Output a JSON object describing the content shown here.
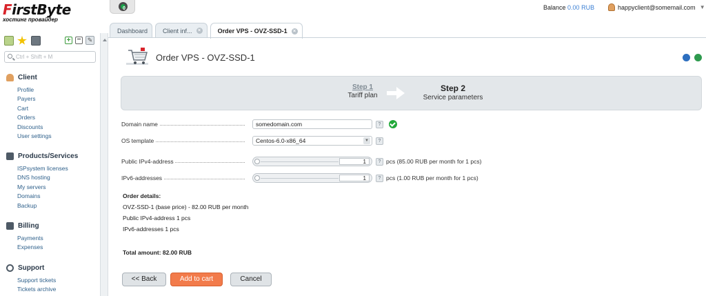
{
  "brand": {
    "logo_main_a": "F",
    "logo_main_b": "irstByte",
    "logo_sub": "хостинг провайдер"
  },
  "notifications": {
    "count": "0"
  },
  "header": {
    "balance_label": "Balance",
    "balance_value": "0.00 RUB",
    "user_email": "happyclient@somemail.com"
  },
  "tabs": [
    {
      "label": "Dashboard",
      "active": false,
      "closable": false
    },
    {
      "label": "Client inf...",
      "active": false,
      "closable": true
    },
    {
      "label": "Order VPS - OVZ-SSD-1",
      "active": true,
      "closable": true
    }
  ],
  "sidebar": {
    "search_placeholder": "Ctrl + Shift + M",
    "sections": [
      {
        "title": "Client",
        "icon": "client-icon",
        "items": [
          "Profile",
          "Payers",
          "Cart",
          "Orders",
          "Discounts",
          "User settings"
        ]
      },
      {
        "title": "Products/Services",
        "icon": "cart-icon",
        "items": [
          "ISPsystem licenses",
          "DNS hosting",
          "My servers",
          "Domains",
          "Backup"
        ]
      },
      {
        "title": "Billing",
        "icon": "billing-icon",
        "items": [
          "Payments",
          "Expenses"
        ]
      },
      {
        "title": "Support",
        "icon": "headset-icon",
        "items": [
          "Support tickets",
          "Tickets archive"
        ]
      }
    ]
  },
  "page": {
    "title": "Order VPS - OVZ-SSD-1"
  },
  "steps": {
    "step1_title": "Step 1",
    "step1_sub": "Tariff plan",
    "step2_title": "Step 2",
    "step2_sub": "Service parameters"
  },
  "form": {
    "domain_label": "Domain name",
    "domain_value": "somedomain.com",
    "os_label": "OS template",
    "os_value": "Centos-6.0-x86_64",
    "ipv4_label": "Public IPv4-address",
    "ipv4_value": "1",
    "ipv4_unit": "pcs (85.00 RUB per month for 1 pcs)",
    "ipv6_label": "IPv6-addresses",
    "ipv6_value": "1",
    "ipv6_unit": "pcs (1.00 RUB per month for 1 pcs)",
    "help_glyph": "?"
  },
  "order": {
    "heading": "Order details:",
    "lines": [
      "OVZ-SSD-1 (base price) - 82.00 RUB per month",
      "Public IPv4-address 1 pcs",
      "IPv6-addresses 1 pcs"
    ],
    "total": "Total amount: 82.00 RUB"
  },
  "buttons": {
    "back": "<< Back",
    "add": "Add to cart",
    "cancel": "Cancel"
  },
  "colors": {
    "brand_red": "#d8232a",
    "link_blue": "#2d5f8a",
    "accent_orange": "#f27b4b",
    "ok_green": "#22a93a"
  }
}
